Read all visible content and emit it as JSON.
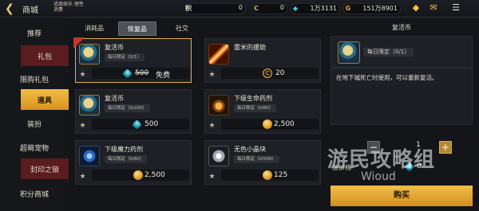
{
  "header": {
    "title": "商城",
    "note": "适度娱乐 理性消费",
    "currencies": [
      {
        "icon": "score-icon",
        "symbol": "积",
        "value": "0"
      },
      {
        "icon": "c-coin-icon",
        "symbol": "C",
        "value": "0"
      },
      {
        "icon": "gem-icon",
        "symbol": "◆",
        "value": "1万3131"
      },
      {
        "icon": "gold-icon",
        "symbol": "G",
        "value": "151万8901"
      }
    ],
    "icons": [
      "gift-icon",
      "mail-icon",
      "menu-icon"
    ]
  },
  "sidebar": {
    "items": [
      {
        "label": "推荐",
        "state": "normal"
      },
      {
        "label": "礼包",
        "state": "red"
      },
      {
        "label": "限购礼包",
        "state": "normal"
      },
      {
        "label": "道具",
        "state": "active"
      },
      {
        "label": "装扮",
        "state": "normal"
      },
      {
        "label": "超萌宠物",
        "state": "normal"
      },
      {
        "label": "封印之锁",
        "state": "red"
      },
      {
        "label": "积分商城",
        "state": "normal"
      }
    ]
  },
  "tabs": [
    {
      "label": "消耗品",
      "active": false
    },
    {
      "label": "恢复品",
      "active": true
    },
    {
      "label": "社交",
      "active": false
    }
  ],
  "items": [
    {
      "name": "复活币",
      "limit": "每日限定（0/1）",
      "icon": "revive-coin-icon",
      "currency": "gem",
      "old_price": "500",
      "price": "免费",
      "selected": true
    },
    {
      "name": "雷米的援助",
      "limit": "",
      "icon": "staff-icon",
      "currency": "c",
      "old_price": "",
      "price": "20",
      "selected": false
    },
    {
      "name": "复活币",
      "limit": "每日限定（0/200）",
      "icon": "revive-coin-icon",
      "currency": "gem",
      "old_price": "",
      "price": "500",
      "selected": false
    },
    {
      "name": "下级生命药剂",
      "limit": "每日限定（0/80）",
      "icon": "life-potion-icon",
      "currency": "gold",
      "old_price": "",
      "price": "2,500",
      "selected": false
    },
    {
      "name": "下级魔力药剂",
      "limit": "每日限定（0/80）",
      "icon": "mana-potion-icon",
      "currency": "gold",
      "old_price": "",
      "price": "2,500",
      "selected": false
    },
    {
      "name": "无色小晶块",
      "limit": "每日限定（0/500）",
      "icon": "crystal-icon",
      "currency": "gold",
      "old_price": "",
      "price": "125",
      "selected": false
    }
  ],
  "detail": {
    "title": "复活币",
    "limit": "每日限定（0/1）",
    "description": "在地下城死亡时使用，可以重新复活。",
    "quantity": "1",
    "total_label": "总价格",
    "total_value": "0",
    "buy_label": "购买"
  },
  "watermark": {
    "line1": "游民攻略组",
    "line2": "Wioud"
  }
}
